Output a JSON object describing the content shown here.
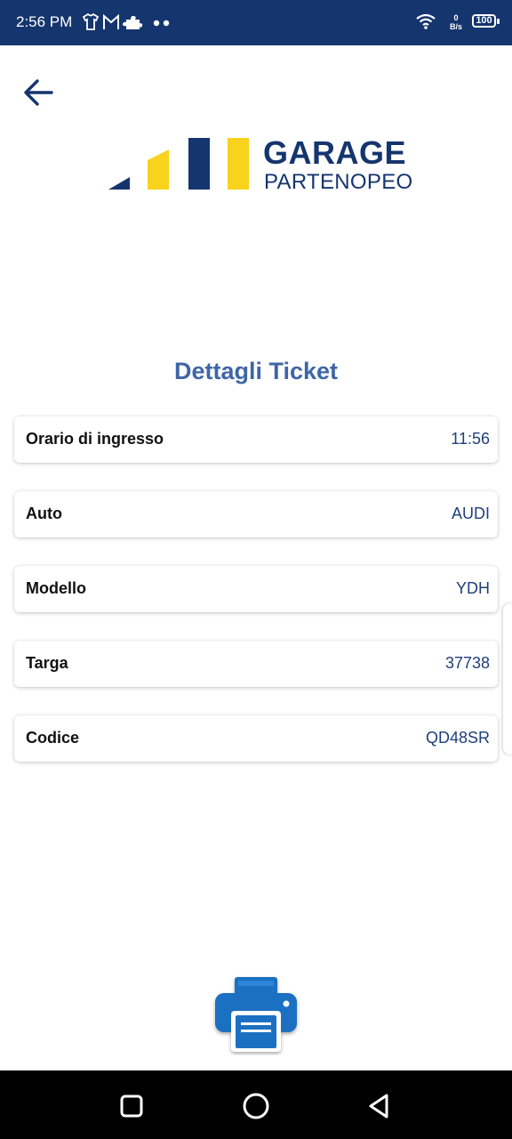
{
  "status_bar": {
    "time": "2:56 PM",
    "icons": [
      "tshirt-icon",
      "gmail-icon",
      "puzzle-icon",
      "more-dots-icon",
      "wifi-icon"
    ],
    "net_speed_value": "0",
    "net_speed_unit": "B/s",
    "battery": "100"
  },
  "header": {
    "back_icon": "arrow-left-icon"
  },
  "logo": {
    "title": "GARAGE",
    "subtitle": "PARTENOPEO",
    "colors": {
      "navy": "#15356e",
      "yellow": "#f9d21c"
    }
  },
  "main": {
    "title": "Dettagli Ticket",
    "details": [
      {
        "label": "Orario di ingresso",
        "value": "11:56"
      },
      {
        "label": "Auto",
        "value": "AUDI"
      },
      {
        "label": "Modello",
        "value": "YDH"
      },
      {
        "label": "Targa",
        "value": "37738"
      },
      {
        "label": "Codice",
        "value": "QD48SR"
      }
    ]
  },
  "actions": {
    "print_icon": "printer-icon",
    "print_color": "#1b6fc2"
  },
  "nav_bar": {
    "buttons": [
      "recents-square-icon",
      "home-circle-icon",
      "back-triangle-icon"
    ]
  }
}
